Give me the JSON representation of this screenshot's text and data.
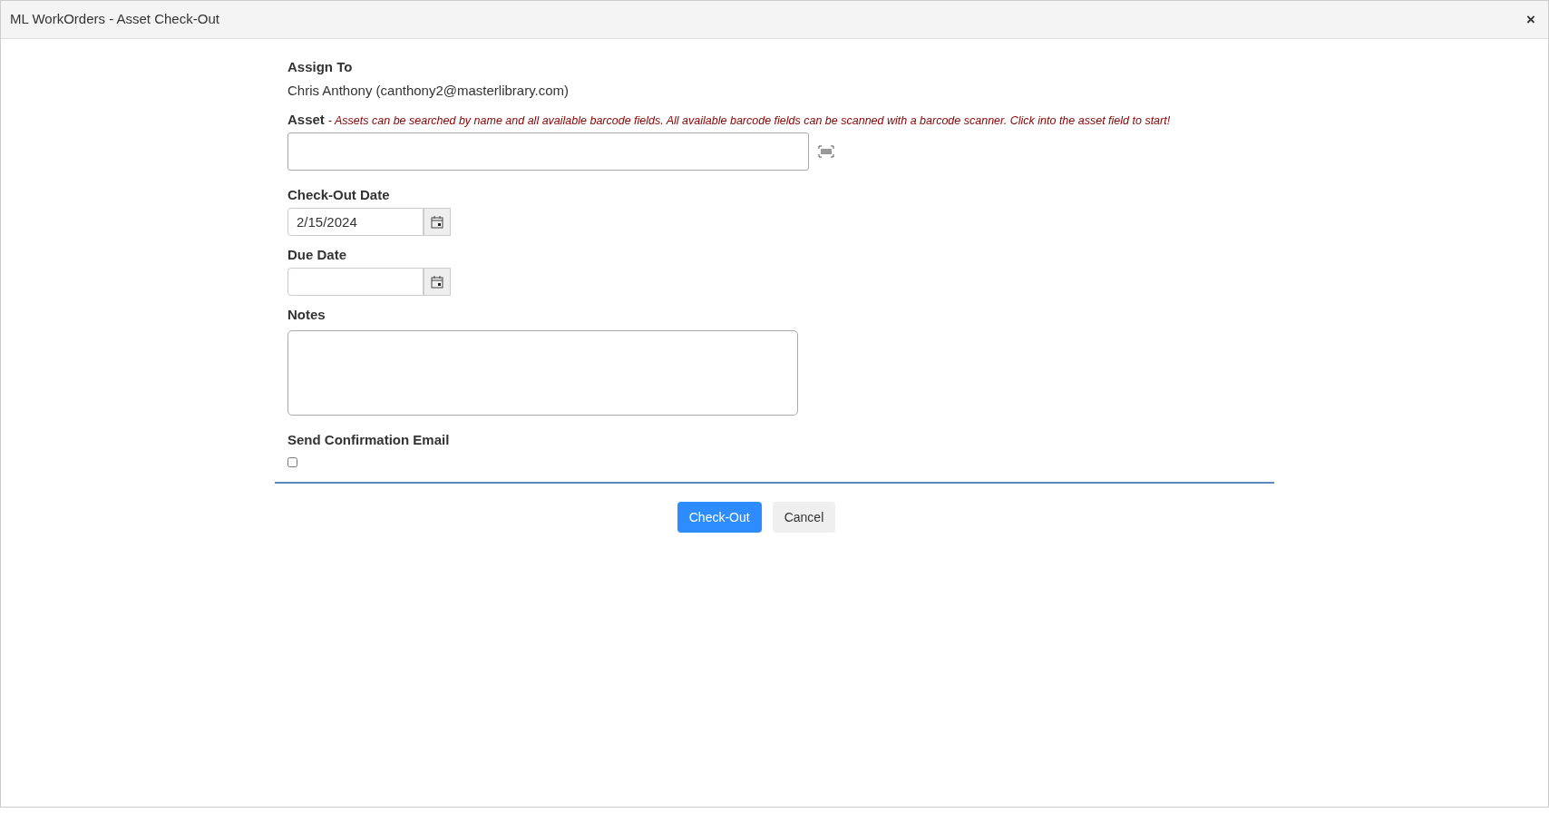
{
  "window": {
    "title": "ML WorkOrders - Asset Check-Out",
    "close": "×"
  },
  "assign_to": {
    "label": "Assign To",
    "value": "Chris Anthony (canthony2@masterlibrary.com)"
  },
  "asset": {
    "label": "Asset",
    "hint": " - Assets can be searched by name and all available barcode fields. All available barcode fields can be scanned with a barcode scanner. Click into the asset field to start!"
  },
  "checkout_date": {
    "label": "Check-Out Date",
    "value": "2/15/2024"
  },
  "due_date": {
    "label": "Due Date"
  },
  "notes": {
    "label": "Notes"
  },
  "send_confirmation": {
    "label": "Send Confirmation Email",
    "checked": false
  },
  "buttons": [
    {
      "label": "Check-Out",
      "kind": "primary"
    },
    {
      "label": "Cancel",
      "kind": "secondary"
    }
  ]
}
